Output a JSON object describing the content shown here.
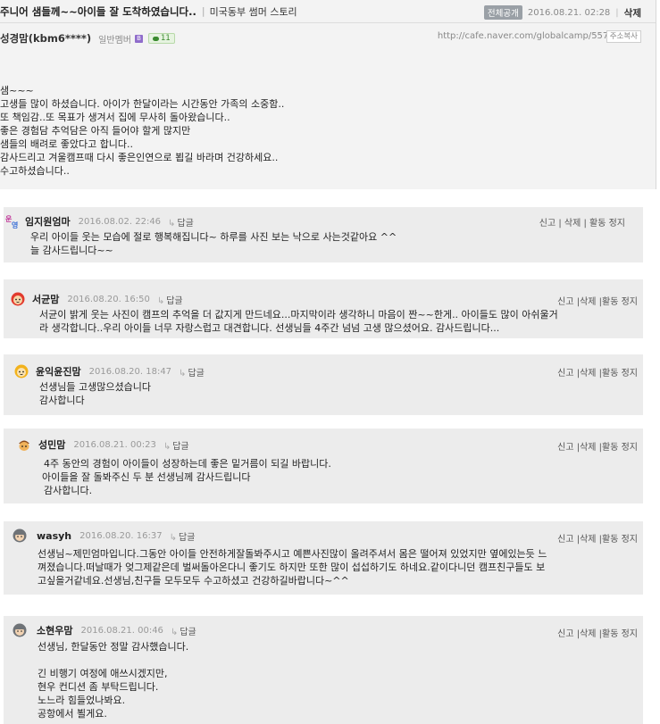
{
  "post": {
    "title": "주니어 샘들께~~아이들 잘 도착하였습니다..",
    "board_name": "미국동부 썸머 스토리",
    "visibility": "전체공개",
    "date": "2016.08.21. 02:28",
    "delete_label": "삭제",
    "author_nick": "성경맘(kbm6****)",
    "member_grade": "일반멤버",
    "grade_icon_text": "B",
    "comment_count": "11",
    "url": "http://cafe.naver.com/globalcamp/55769",
    "copy_label": "주소복사",
    "body_lines": [
      "샘~~~",
      "고생들 많이 하셨습니다. 아이가 한달이라는 시간동안 가족의 소중함..",
      "또 책임감..또 목표가 생겨서 집에 무사히 돌아왔습니다..",
      "좋은 경험담 추억담은 아직 들어야 할게 많지만",
      "샘들의 배려로 좋았다고 합니다..",
      "감사드리고 겨울캠프때 다시 좋은인연으로 뵙길 바라며 건강하세요..",
      "수고하셨습니다.."
    ]
  },
  "comments": [
    {
      "nick": "임지원엄마",
      "date": "2016.08.02. 22:46",
      "reply": "답글",
      "actions": "신고 | 삭제 | 활동 정지",
      "avatar_icon": "staff-badge-icon",
      "lines": [
        "우리 아이들 웃는 모습에 절로 행복해집니다~ 하루를 사진 보는 낙으로 사는것같아요 ^^",
        "늘 감사드립니다~~"
      ]
    },
    {
      "nick": "서균맘",
      "date": "2016.08.20. 16:50",
      "reply": "답글",
      "actions": "신고 |삭제 |활동 정지",
      "avatar_icon": "red-mascot-icon",
      "lines": [
        "서균이 밝게 웃는 사진이 캠프의 추억을 더 값지게 만드네요...마지막이라 생각하니 마음이 짠~~한게.. 아이들도 많이 아쉬울거",
        "라 생각합니다..우리 아이들 너무 자랑스럽고 대견합니다. 선생님들 4주간 넘넘 고생 많으셨어요. 감사드립니다..."
      ]
    },
    {
      "nick": "윤익윤진맘",
      "date": "2016.08.20. 18:47",
      "reply": "답글",
      "actions": "신고 |삭제 |활동 정지",
      "avatar_icon": "yellow-mascot-icon",
      "lines": [
        "선생님들 고생많으셨습니다",
        "감사합니다"
      ]
    },
    {
      "nick": "성민맘",
      "date": "2016.08.21. 00:23",
      "reply": "답글",
      "actions": "신고 |삭제 |활동 정지",
      "avatar_icon": "acorn-mascot-icon",
      "lines": [
        "4주 동안의 경험이 아이들이 성장하는데 좋은 밑거름이 되길 바랍니다.",
        "아이들을 잘 돌봐주신 두 분 선생님께 감사드립니다",
        "감사합니다."
      ]
    },
    {
      "nick": "wasyh",
      "date": "2016.08.20. 16:37",
      "reply": "답글",
      "actions": "신고 |삭제 |활동 정지",
      "avatar_icon": "default-profile-icon",
      "lines": [
        "선생님~제민엄마입니다.그동안 아이들 안전하게잘돌봐주시고 예쁜사진많이 올려주셔서 몸은 떨어져 있었지만 옆에있는듯 느",
        "껴졌습니다.떠날때가 엊그제같은데 벌써돌아온다니 좋기도 하지만 또한 많이 섭섭하기도 하네요.같이다니던 캠프친구들도 보",
        "고싶을거같네요.선생님,친구들 모두모두 수고하셨고 건강하길바랍니다~^^"
      ]
    },
    {
      "nick": "소현우맘",
      "date": "2016.08.21. 00:46",
      "reply": "답글",
      "actions": "신고 |삭제 |활동 정지",
      "avatar_icon": "default-profile-icon",
      "lines": [
        "선생님, 한달동안 정말 감사했습니다.",
        "",
        "긴 비행기 여정에 애쓰시겠지만,",
        "현우 컨디션 좀 부탁드립니다.",
        "노느라 힘들었나봐요.",
        "공항에서 뵐게요."
      ]
    }
  ]
}
